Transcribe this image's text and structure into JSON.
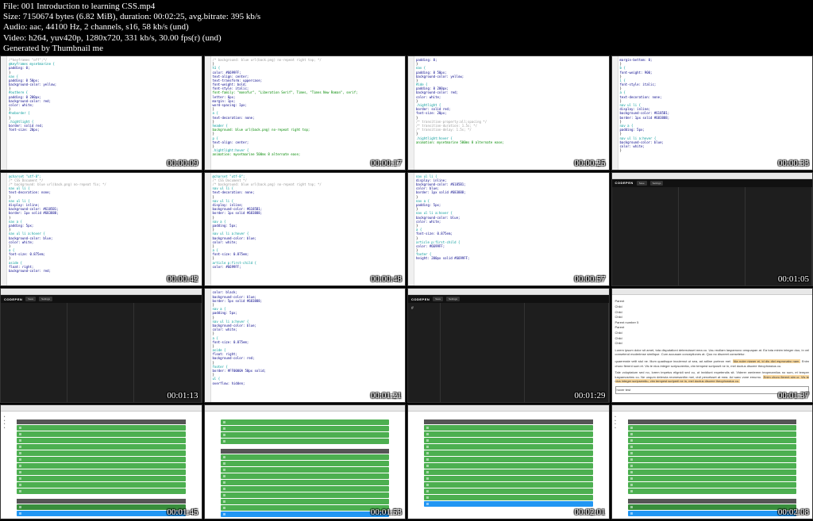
{
  "header": {
    "file": "File: 001 Introduction to learning CSS.mp4",
    "size": "Size: 7150674 bytes (6.82 MiB), duration: 00:02:25, avg.bitrate: 395 kb/s",
    "audio": "Audio: aac, 44100 Hz, 2 channels, s16, 58 kb/s (und)",
    "video": "Video: h264, yuv420p, 1280x720, 331 kb/s, 30.00 fps(r) (und)",
    "generated": "Generated by Thumbnail me"
  },
  "timestamps": [
    "00:00:09",
    "00:00:17",
    "00:00:25",
    "00:00:33",
    "00:00:42",
    "00:00:48",
    "00:00:57",
    "00:01:05",
    "00:01:13",
    "00:01:21",
    "00:01:29",
    "00:01:37",
    "00:01:45",
    "00:01:53",
    "00:02:01",
    "00:02:08"
  ],
  "codepen": {
    "logo": "CODEPEN",
    "btn1": "Save",
    "btn2": "Settings"
  },
  "code_snippets": {
    "keyframes": "@keyframes mysetmarine {",
    "padding": "padding: 0;",
    "margin": "margin-bottom: 0;",
    "color": "color: #6699FF;",
    "textalign": "text-align: center;",
    "texttrans": "text-transform: uppercase;",
    "fontweight": "font-weight: bold;",
    "fontstyle": "font-style: italic;",
    "fontfam": "font-family: \"monofur\", \"Liberation Serif\", Times, \"Times New Roman\", serif;",
    "fontsize": "font-size: 20px;",
    "textdeco": "text-decoration: none;",
    "bg": "background: blue url(back.png) no-repeat right top;",
    "display": "display: inline;",
    "bgcolor": "background-color: #6185B1;",
    "border": "border: 1px solid #683888;",
    "float": "float: right;",
    "animation": "animation: mysetmarine 500ms 8 alternate ease;",
    "hightlight": ".hightlight {",
    "nav": "nav ul li {",
    "article": "article p:first-child {",
    "hover": "nav ul li a:hover {"
  },
  "text_content": {
    "items": [
      "Parent",
      "Child",
      "Child",
      "Child",
      "Parent number 5",
      "Parent",
      "Child",
      "Child",
      "Child"
    ],
    "para1": "Lorem ipsum dolor sit amet, tota disputationi deterruisset mea cu. Usu mollam laspamovo omquapan at. Ea tota minim integer duo, in vel consetend moderimse similique. Cum accusam conceptiones at. Quo no discreet consetetur.",
    "para2_a": "quaererate velit stul ne. Illum quadisque inculernut ut sea, ad adline porteon mel.",
    "para2_hl": "Nia noler nianer ei, id dis dict espronabo nam.",
    "para2_b": "Enim choro fierent sum et. Vis te nius integer scripsorentia, vim tempest scriposril ne in, mel doctus discere theophrastus cu.",
    "para3": "Tale voluptatum sed no, lorem impetus elignidi sed cu, ut invidiunt expetendis sit. Viderer werierem teopmamiius no sum, et temper luspamosrims cu. Ne unqum deleruta reomesanthn mei, civil percelsset at mea. Ad sanc vone emurno.",
    "para3_hl": "Enim choro fierent sim cr. Vis te nius integer scripsemtiu, vim tempest scriperil ne in, mel doctus discere theophrastus cu.",
    "footer": "hover test"
  }
}
